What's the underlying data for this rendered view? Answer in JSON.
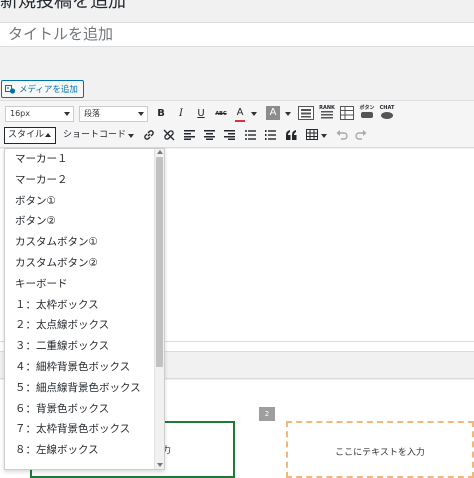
{
  "page": {
    "heading": "新規投稿を追加"
  },
  "title_field": {
    "placeholder": "タイトルを追加"
  },
  "media_button": {
    "label": "メディアを追加"
  },
  "toolbar": {
    "font_size": "16px",
    "paragraph": "段落",
    "bold": "B",
    "italic": "I",
    "underline": "U",
    "strikethrough": "ABC",
    "text_color": "A",
    "background_color": "A",
    "rank_label": "RANK",
    "button_label": "ボタン",
    "chat_label": "CHAT",
    "style_button": "スタイル",
    "shortcode": "ショートコード"
  },
  "style_menu": {
    "items": [
      "マーカー１",
      "マーカー２",
      "ボタン①",
      "ボタン②",
      "カスタムボタン①",
      "カスタムボタン②",
      "キーボード",
      "１：太枠ボックス",
      "２：太点線ボックス",
      "３：二重線ボックス",
      "４：細枠背景色ボックス",
      "５：細点線背景色ボックス",
      "６：背景色ボックス",
      "７：太枠背景色ボックス",
      "８：左線ボックス"
    ]
  },
  "blocks": {
    "green_box_text": "入力",
    "badge": "2",
    "orange_box_text": "ここにテキストを入力"
  },
  "colors": {
    "accent": "#0073aa",
    "green_border": "#1e7b34",
    "orange_border": "#f0b87a",
    "text_color_underline": "#d63638"
  }
}
